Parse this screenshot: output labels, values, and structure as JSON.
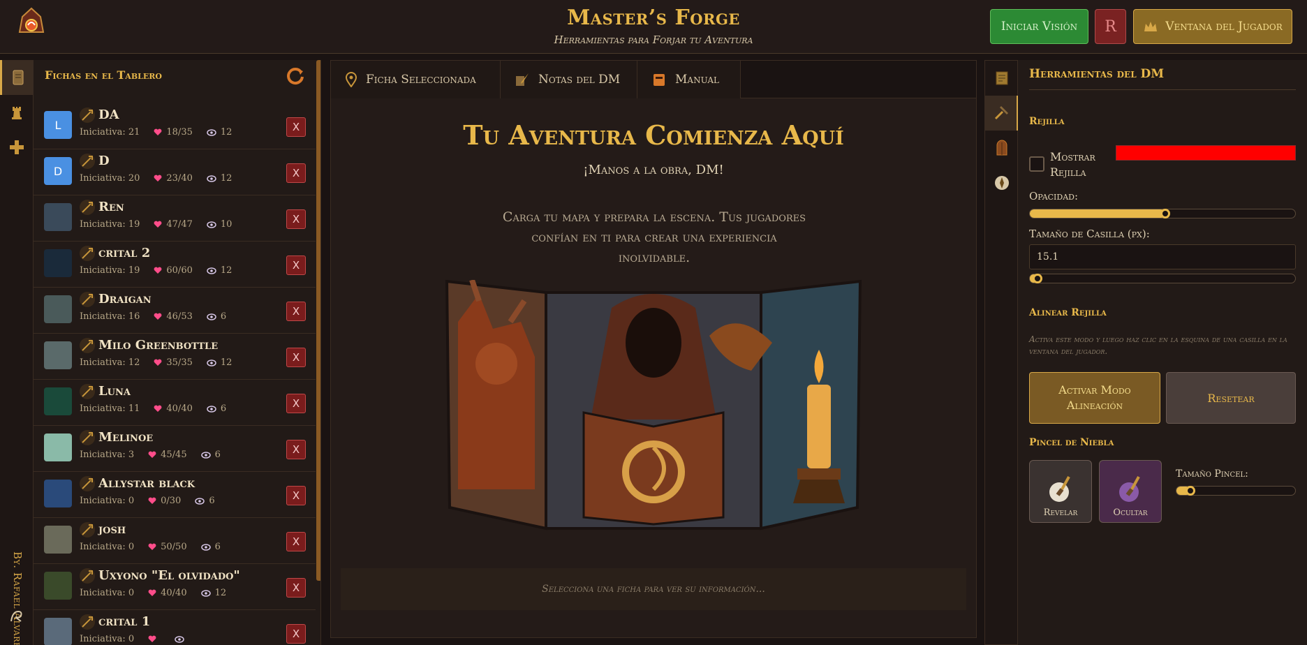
{
  "header": {
    "title": "Master’s Forge",
    "subtitle": "Herramientas para Forjar tu Aventura",
    "buttons": {
      "vision": "Iniciar Visión",
      "r": "R",
      "player_window": "Ventana del Jugador"
    }
  },
  "left_panel": {
    "title": "Fichas en el Tablero",
    "credit": "By. Rafael Alvarez."
  },
  "tokens": [
    {
      "name": "DA",
      "initiative": "Iniciativa: 21",
      "hp": "18/35",
      "vision": "12",
      "avatar": "L",
      "avatar_color": "#4a90e2",
      "remove": "X"
    },
    {
      "name": "D",
      "initiative": "Iniciativa: 20",
      "hp": "23/40",
      "vision": "12",
      "avatar": "D",
      "avatar_color": "#4a90e2",
      "remove": "X"
    },
    {
      "name": "Ren",
      "initiative": "Iniciativa: 19",
      "hp": "47/47",
      "vision": "10",
      "avatar": "",
      "avatar_color": "#3a4a5a",
      "remove": "X"
    },
    {
      "name": "crital 2",
      "initiative": "Iniciativa: 19",
      "hp": "60/60",
      "vision": "12",
      "avatar": "",
      "avatar_color": "#1a2a3a",
      "remove": "X"
    },
    {
      "name": "Draigan",
      "initiative": "Iniciativa: 16",
      "hp": "46/53",
      "vision": "6",
      "avatar": "",
      "avatar_color": "#4a5a5a",
      "remove": "X"
    },
    {
      "name": "Milo Greenbottle",
      "initiative": "Iniciativa: 12",
      "hp": "35/35",
      "vision": "12",
      "avatar": "",
      "avatar_color": "#5a6a6a",
      "remove": "X"
    },
    {
      "name": "Luna",
      "initiative": "Iniciativa: 11",
      "hp": "40/40",
      "vision": "6",
      "avatar": "",
      "avatar_color": "#1a4a3a",
      "remove": "X"
    },
    {
      "name": "Melinoe",
      "initiative": "Iniciativa: 3",
      "hp": "45/45",
      "vision": "6",
      "avatar": "",
      "avatar_color": "#8abaa8",
      "remove": "X"
    },
    {
      "name": "Allystar black",
      "initiative": "Iniciativa: 0",
      "hp": "0/30",
      "vision": "6",
      "avatar": "",
      "avatar_color": "#2a4a7a",
      "remove": "X"
    },
    {
      "name": "josh",
      "initiative": "Iniciativa: 0",
      "hp": "50/50",
      "vision": "6",
      "avatar": "",
      "avatar_color": "#6a6a5a",
      "remove": "X"
    },
    {
      "name": "Uxyono \"El olvidado\"",
      "initiative": "Iniciativa: 0",
      "hp": "40/40",
      "vision": "12",
      "avatar": "",
      "avatar_color": "#3a4a2a",
      "remove": "X"
    },
    {
      "name": "crital 1",
      "initiative": "Iniciativa: 0",
      "hp": "",
      "vision": "",
      "avatar": "",
      "avatar_color": "#5a6a7a",
      "remove": "X"
    }
  ],
  "center": {
    "tabs": [
      "Ficha Seleccionada",
      "Notas del DM",
      "Manual"
    ],
    "title": "Tu Aventura Comienza Aquí",
    "subtitle": "¡Manos a la obra, DM!",
    "body": "Carga tu mapa y prepara la escena. Tus jugadores confían en ti para crear una experiencia inolvidable.",
    "info": "Selecciona una ficha para ver su información..."
  },
  "tools": {
    "title": "Herramientas del DM",
    "grid_section": "Rejilla",
    "show_grid": "Mostrar Rejilla",
    "grid_color": "#ff0000",
    "opacity_label": "Opacidad:",
    "opacity_value": 0.51,
    "cell_size_label": "Tamaño de Casilla (px):",
    "cell_size_value": "15.1",
    "cell_size_slider": 0.03,
    "align_section": "Alinear Rejilla",
    "align_hint": "Activa este modo y luego haz clic en la esquina de una casilla en la ventana del jugador.",
    "align_button": "Activar Modo Alineación",
    "reset_button": "Resetear",
    "fog_section": "Pincel de Niebla",
    "reveal": "Revelar",
    "hide": "Ocultar",
    "brush_size_label": "Tamaño Pincel:",
    "brush_size_value": 0.12
  },
  "colors": {
    "accent": "#e8b84a",
    "danger": "#7a1c1c",
    "heart": "#ff4d8a"
  }
}
